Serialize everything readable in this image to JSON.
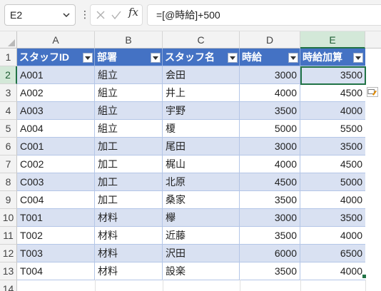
{
  "name_box": {
    "value": "E2"
  },
  "formula_bar": {
    "fx_label": "fx",
    "formula": "=[@時給]+500"
  },
  "columns": [
    "A",
    "B",
    "C",
    "D",
    "E"
  ],
  "selected_column": "E",
  "selected_row": "2",
  "row_numbers": [
    "1",
    "2",
    "3",
    "4",
    "5",
    "6",
    "7",
    "8",
    "9",
    "10",
    "11",
    "12",
    "13",
    "14"
  ],
  "table": {
    "headers": [
      "スタッフID",
      "部署",
      "スタッフ名",
      "時給",
      "時給加算"
    ],
    "rows": [
      [
        "A001",
        "組立",
        "会田",
        "3000",
        "3500"
      ],
      [
        "A002",
        "組立",
        "井上",
        "4000",
        "4500"
      ],
      [
        "A003",
        "組立",
        "宇野",
        "3500",
        "4000"
      ],
      [
        "A004",
        "組立",
        "榎",
        "5000",
        "5500"
      ],
      [
        "C001",
        "加工",
        "尾田",
        "3000",
        "3500"
      ],
      [
        "C002",
        "加工",
        "梶山",
        "4000",
        "4500"
      ],
      [
        "C003",
        "加工",
        "北原",
        "4500",
        "5000"
      ],
      [
        "C004",
        "加工",
        "桑家",
        "3500",
        "4000"
      ],
      [
        "T001",
        "材料",
        "欅",
        "3000",
        "3500"
      ],
      [
        "T002",
        "材料",
        "近藤",
        "3500",
        "4000"
      ],
      [
        "T003",
        "材料",
        "沢田",
        "6000",
        "6500"
      ],
      [
        "T004",
        "材料",
        "設楽",
        "3500",
        "4000"
      ]
    ]
  },
  "colors": {
    "header": "#4472c4",
    "band": "#d9e1f2",
    "selection": "#217346"
  }
}
